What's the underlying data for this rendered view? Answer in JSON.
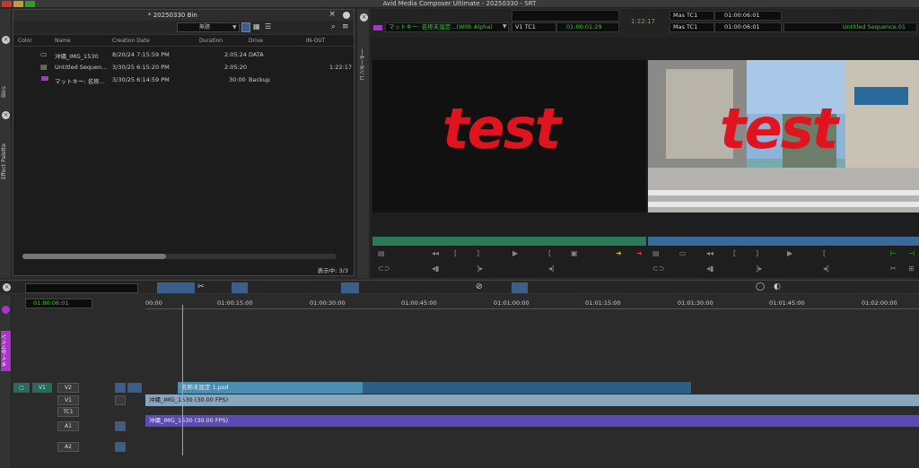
{
  "window": {
    "title": "Avid Media Composer Ultimate - 20250330 - SRT"
  },
  "leftstrip": {
    "bins_tab": "Bins",
    "effect_tab": "Effect Palette"
  },
  "bin": {
    "title": "* 20250330 Bin",
    "dropdown": "無題",
    "columns": [
      "Color",
      "Name",
      "Creation Date",
      "Duration",
      "Drive",
      "IN-OUT"
    ],
    "rows": [
      {
        "name": "沖縄_IMG_1530",
        "date": "8/20/24 7:15:59 PM",
        "duration": "2:05:24",
        "drive": "DATA",
        "inout": ""
      },
      {
        "name": "Untitled Sequen...",
        "date": "3/30/25 6:15:20 PM",
        "duration": "2:05:20",
        "drive": "",
        "inout": "1:22:17"
      },
      {
        "name": "マットキー: 名称...",
        "date": "3/30/25 6:14:59 PM",
        "duration": "30:00",
        "drive": "Backup",
        "inout": ""
      }
    ],
    "status": "表示中: 3/3"
  },
  "midstrip": {
    "tab": "コンポーザー"
  },
  "monitors": {
    "src_menu": "マットキー: 名称未設定...(With Alpha)",
    "src_tc_label": "V1  TC1",
    "src_tc": "01:00:01:29",
    "center_tc": "1:22:17",
    "rec_tc_label1": "Mas  TC1",
    "rec_tc1": "01:00:06:01",
    "rec_tc_label2": "Mas  TC1",
    "rec_tc2": "01:00:06:01",
    "rec_seq": "Untitled Sequence.01",
    "src_text": "test",
    "rec_text": "test"
  },
  "timeline": {
    "strip_tab": "タイムライン",
    "tc": "01:00:06:01",
    "ruler": [
      "00:00",
      "01:00:15:00",
      "01:00:30:00",
      "01:00:45:00",
      "01:01:00:00",
      "01:01:15:00",
      "01:01:30:00",
      "01:01:45:00",
      "01:02:00:00"
    ],
    "tracks": [
      "V2",
      "V1",
      "TC1",
      "A1",
      "A2"
    ],
    "v1_rec": "V1",
    "v2_clip": "名称未設定 1.psd",
    "v1_clip": "沖縄_IMG_1530 (30.00 FPS)",
    "a1_clip": "沖縄_IMG_1530 (30.00 FPS)"
  }
}
